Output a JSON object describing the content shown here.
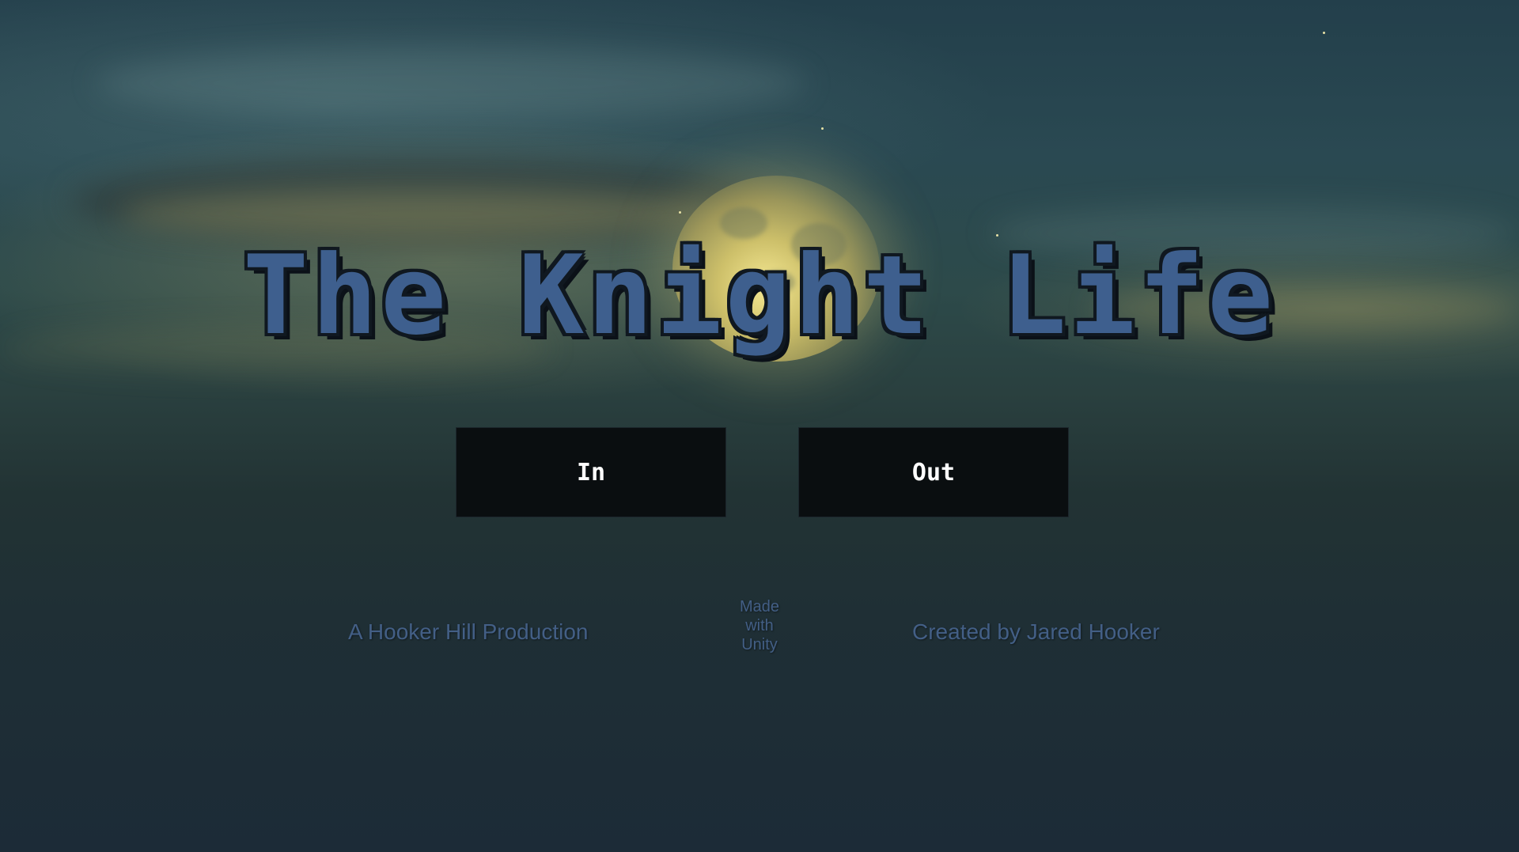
{
  "game": {
    "title": "The Knight Life"
  },
  "menu": {
    "in_label": "In",
    "out_label": "Out"
  },
  "credits": {
    "production": "A Hooker Hill Production",
    "made_with": [
      "Made",
      "with",
      "Unity"
    ],
    "creator": "Created by Jared Hooker"
  },
  "colors": {
    "title_fill": "#3e5f8e",
    "title_outline": "#101820",
    "button_bg": "#0a0e10",
    "button_text": "#ffffff",
    "credit_text": "#435f86"
  }
}
